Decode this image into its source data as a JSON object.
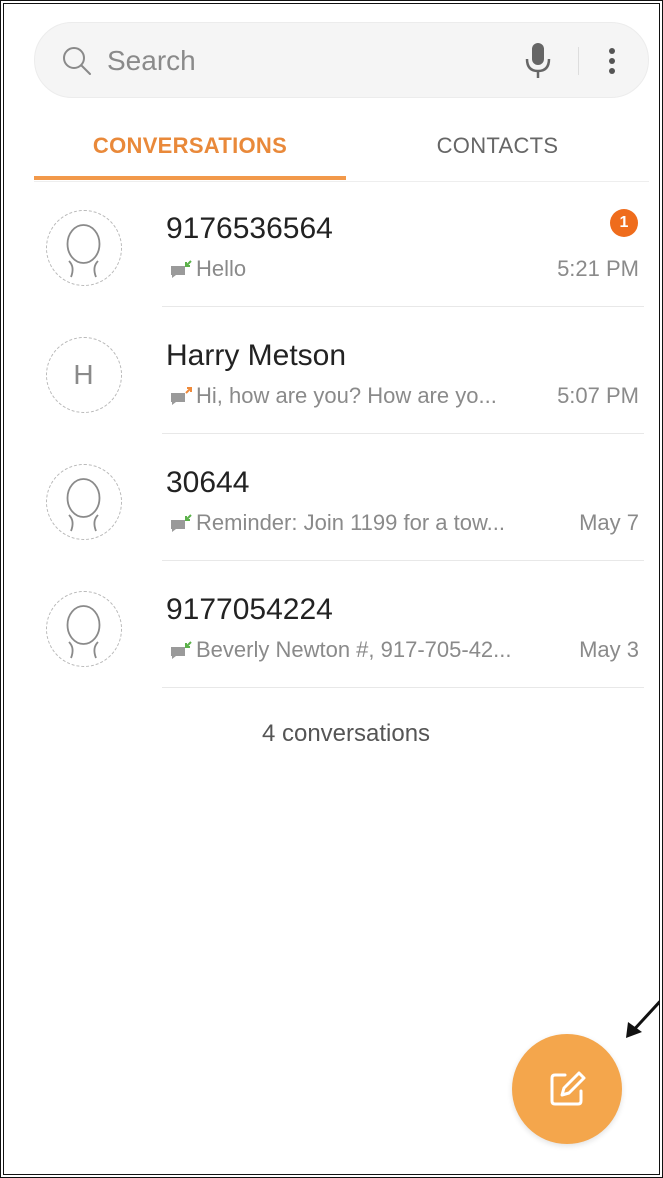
{
  "search": {
    "placeholder": "Search"
  },
  "tabs": [
    {
      "label": "CONVERSATIONS",
      "active": true
    },
    {
      "label": "CONTACTS",
      "active": false
    }
  ],
  "conversations": [
    {
      "name": "9176536564",
      "preview": "Hello",
      "time": "5:21 PM",
      "unread": "1",
      "avatar": "person",
      "direction": "incoming"
    },
    {
      "name": "Harry Metson",
      "preview": "Hi, how are you? How are yo...",
      "time": "5:07 PM",
      "avatar": "letter",
      "initial": "H",
      "direction": "outgoing"
    },
    {
      "name": "30644",
      "preview": "Reminder: Join 1199 for a tow...",
      "time": "May 7",
      "avatar": "person",
      "direction": "incoming"
    },
    {
      "name": "9177054224",
      "preview": "Beverly Newton #, 917-705-42...",
      "time": "May 3",
      "avatar": "person",
      "direction": "incoming"
    }
  ],
  "footer": {
    "count_text": "4 conversations"
  },
  "colors": {
    "accent": "#e9893a",
    "fab": "#f4a64c",
    "badge": "#ef6c1c"
  },
  "icons": [
    "search-icon",
    "mic-icon",
    "more-vert-icon",
    "person-icon",
    "message-incoming-icon",
    "message-outgoing-icon",
    "compose-icon",
    "arrow-icon"
  ]
}
